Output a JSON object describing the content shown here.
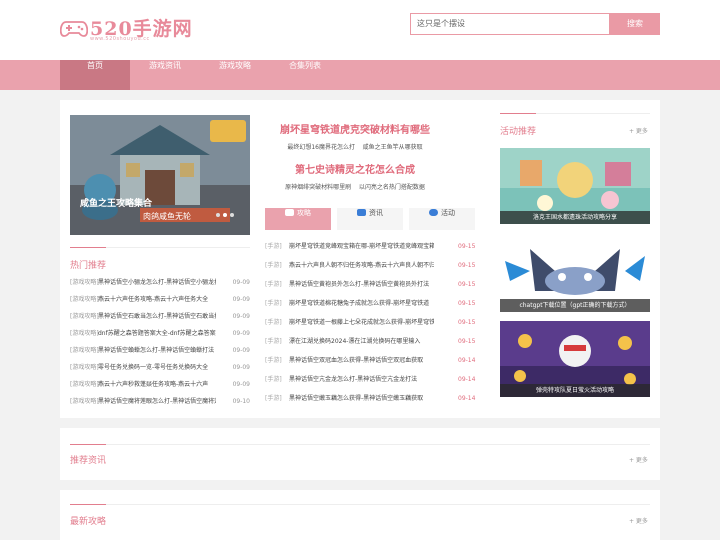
{
  "header": {
    "logo_text": "520手游网",
    "logo_sub": "www.520shouyou.cc",
    "search_placeholder": "这只是个摆设",
    "search_button": "搜索"
  },
  "nav": [
    "首页",
    "游戏资讯",
    "游戏攻略",
    "合集列表"
  ],
  "slider": {
    "caption": "咸鱼之王攻略集合",
    "overlay_text": "肉鸽咸鱼无轮"
  },
  "hot": {
    "title": "热门推荐",
    "items": [
      {
        "cat": "[游戏攻略]",
        "title": "黑神话悟空小骊龙怎么打-黑神话悟空小骊龙打法攻略",
        "date": "09-09"
      },
      {
        "cat": "[游戏攻略]",
        "title": "燕云十六声任务攻略-燕云十六声任务大全",
        "date": "09-09"
      },
      {
        "cat": "[游戏攻略]",
        "title": "黑神话悟空石敢当怎么打-黑神话悟空石敢当打法",
        "date": "09-09"
      },
      {
        "cat": "[游戏攻略]",
        "title": "dnf苏醒之森答题答案大全-dnf苏醒之森答案",
        "date": "09-09"
      },
      {
        "cat": "[游戏攻略]",
        "title": "黑神话悟空蝜蝂怎么打-黑神话悟空蝜蝂打法",
        "date": "09-09"
      },
      {
        "cat": "[游戏攻略]",
        "title": "零号任务兑换码一览-零号任务兑换码大全",
        "date": "09-09"
      },
      {
        "cat": "[游戏攻略]",
        "title": "燕云十六声秒救蓬燚任务攻略-燕云十六声",
        "date": "09-09"
      },
      {
        "cat": "[游戏攻略]",
        "title": "黑神话悟空魔将莲眼怎么打-黑神话悟空魔将莲眼",
        "date": "09-10"
      }
    ]
  },
  "center": {
    "headline1": "崩坏星穹铁道虎克突破材料有哪些",
    "sub1": [
      "最终幻想16魔界花怎么打",
      "咸鱼之王鱼竿从哪获取"
    ],
    "headline2": "第七史诗精灵之花怎么合成",
    "sub2": [
      "原神烟绯突破材料哪里刷",
      "以闪亮之名热门搭配数据"
    ],
    "tabs": [
      {
        "label": "攻略",
        "icon": "book-icon"
      },
      {
        "label": "资讯",
        "icon": "monitor-icon"
      },
      {
        "label": "活动",
        "icon": "gamepad-icon"
      }
    ],
    "list": [
      {
        "cat": "[手游]",
        "title": "崩坏星穹铁道竞峰观宝箱在哪-崩坏星穹铁道竞峰观宝箱位置",
        "date": "09-15"
      },
      {
        "cat": "[手游]",
        "title": "燕云十六声良人朝不归任务攻略-燕云十六声良人朝不归",
        "date": "09-15"
      },
      {
        "cat": "[手游]",
        "title": "黑神话悟空黄袍员外怎么打-黑神话悟空黄袍员外打法",
        "date": "09-15"
      },
      {
        "cat": "[手游]",
        "title": "崩坏星穹铁道棉花糖兔子成就怎么获得-崩坏星穹铁道",
        "date": "09-15"
      },
      {
        "cat": "[手游]",
        "title": "崩坏星穹铁道一根藤上七朵花成就怎么获得-崩坏星穹铁道",
        "date": "09-15"
      },
      {
        "cat": "[手游]",
        "title": "漂在江湖兑换码2024-漂在江湖兑换码在哪里输入",
        "date": "09-15"
      },
      {
        "cat": "[手游]",
        "title": "黑神话悟空双冠血怎么获得-黑神话悟空双冠血获取",
        "date": "09-14"
      },
      {
        "cat": "[手游]",
        "title": "黑神话悟空亢金龙怎么打-黑神话悟空亢金龙打法",
        "date": "09-14"
      },
      {
        "cat": "[手游]",
        "title": "黑神话悟空嫩玉藕怎么获得-黑神话悟空嫩玉藕获取",
        "date": "09-14"
      }
    ]
  },
  "activity": {
    "title": "活动推荐",
    "more": "+ 更多",
    "items": [
      {
        "caption": "洛克王国水都遗珠活动攻略分享"
      },
      {
        "caption": "chatgpt下载位置（gpt正确的下载方式）"
      },
      {
        "caption": "弹壳特攻队夏日萤火活动攻略"
      }
    ]
  },
  "sections": {
    "recommend": {
      "title": "推荐资讯",
      "more": "+ 更多"
    },
    "latest": {
      "title": "最新攻略",
      "more": "+ 更多"
    }
  }
}
